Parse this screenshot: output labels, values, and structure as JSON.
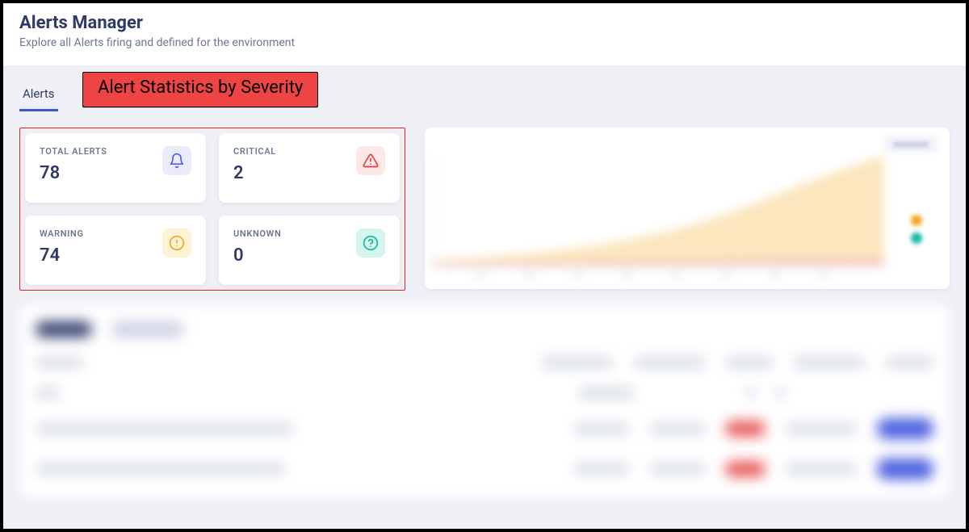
{
  "header": {
    "title": "Alerts Manager",
    "subtitle": "Explore all Alerts firing and defined for the environment"
  },
  "tabs": {
    "active_label": "Alerts"
  },
  "callout": {
    "text": "Alert Statistics by Severity"
  },
  "stats": {
    "total": {
      "label": "TOTAL ALERTS",
      "value": "78"
    },
    "critical": {
      "label": "CRITICAL",
      "value": "2"
    },
    "warning": {
      "label": "WARNING",
      "value": "74"
    },
    "unknown": {
      "label": "UNKNOWN",
      "value": "0"
    }
  },
  "colors": {
    "legend_red": "#e85c5c",
    "legend_amber": "#f5a623",
    "legend_teal": "#14b8a6"
  }
}
